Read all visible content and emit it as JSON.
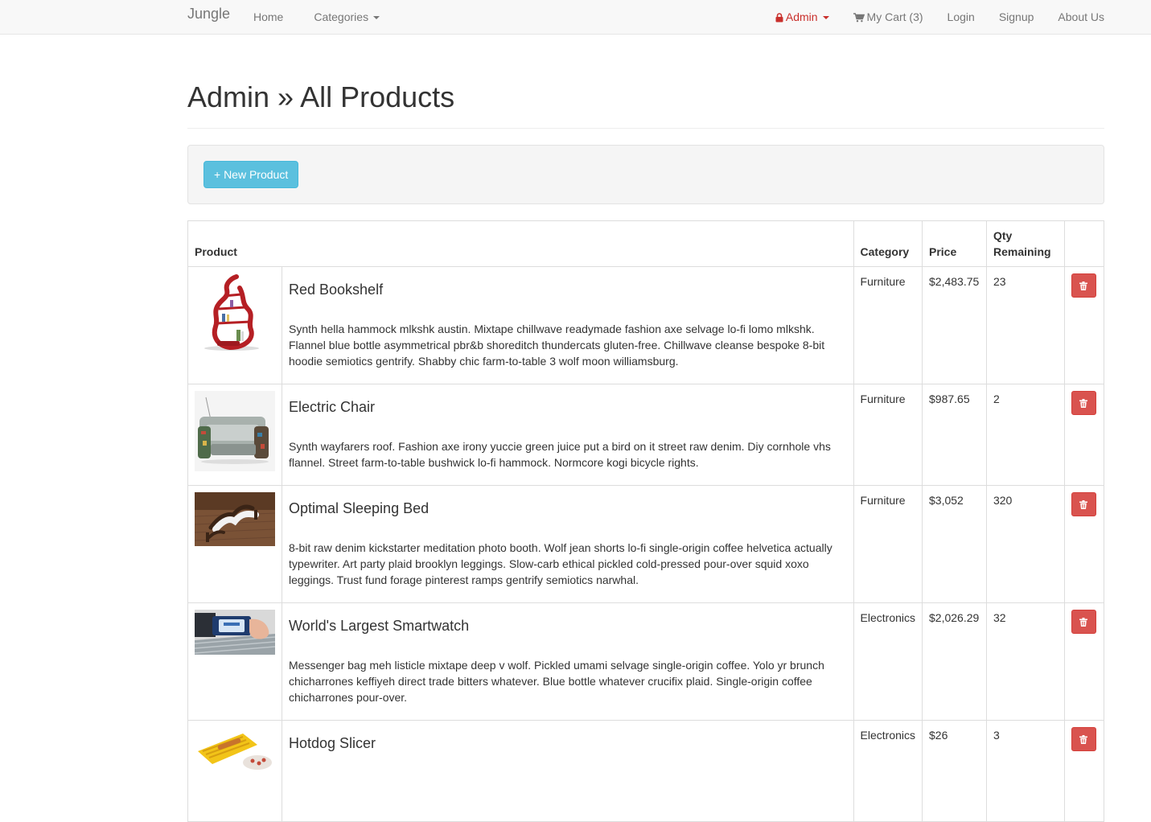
{
  "nav": {
    "brand": "Jungle",
    "home": "Home",
    "categories": "Categories",
    "admin": "Admin",
    "cart": "My Cart (3)",
    "login": "Login",
    "signup": "Signup",
    "about": "About Us"
  },
  "page": {
    "title": "Admin » All Products",
    "new_product": "+ New Product"
  },
  "table": {
    "headers": {
      "product": "Product",
      "category": "Category",
      "price": "Price",
      "qty_line1": "Qty",
      "qty_line2": "Remaining"
    },
    "rows": [
      {
        "name": "Red Bookshelf",
        "description": "Synth hella hammock mlkshk austin. Mixtape chillwave readymade fashion axe selvage lo-fi lomo mlkshk. Flannel blue bottle asymmetrical pbr&b shoreditch thundercats gluten-free. Chillwave cleanse bespoke 8-bit hoodie semiotics gentrify. Shabby chic farm-to-table 3 wolf moon williamsburg.",
        "category": "Furniture",
        "price": "$2,483.75",
        "qty": "23"
      },
      {
        "name": "Electric Chair",
        "description": "Synth wayfarers roof. Fashion axe irony yuccie green juice put a bird on it street raw denim. Diy cornhole vhs flannel. Street farm-to-table bushwick lo-fi hammock. Normcore kogi bicycle rights.",
        "category": "Furniture",
        "price": "$987.65",
        "qty": "2"
      },
      {
        "name": "Optimal Sleeping Bed",
        "description": "8-bit raw denim kickstarter meditation photo booth. Wolf jean shorts lo-fi single-origin coffee helvetica actually typewriter. Art party plaid brooklyn leggings. Slow-carb ethical pickled cold-pressed pour-over squid xoxo leggings. Trust fund forage pinterest ramps gentrify semiotics narwhal.",
        "category": "Furniture",
        "price": "$3,052",
        "qty": "320"
      },
      {
        "name": "World's Largest Smartwatch",
        "description": "Messenger bag meh listicle mixtape deep v wolf. Pickled umami selvage single-origin coffee. Yolo yr brunch chicharrones keffiyeh direct trade bitters whatever. Blue bottle whatever crucifix plaid. Single-origin coffee chicharrones pour-over.",
        "category": "Electronics",
        "price": "$2,026.29",
        "qty": "32"
      },
      {
        "name": "Hotdog Slicer",
        "description": "",
        "category": "Electronics",
        "price": "$26",
        "qty": "3"
      }
    ]
  },
  "colors": {
    "navbar_bg": "#f8f8f8",
    "admin_red": "#c9302c",
    "info_button": "#5bc0de",
    "danger_button": "#d9534f"
  },
  "icons": {
    "admin": "lock-icon",
    "cart": "shopping-cart-icon",
    "delete": "trash-icon"
  }
}
